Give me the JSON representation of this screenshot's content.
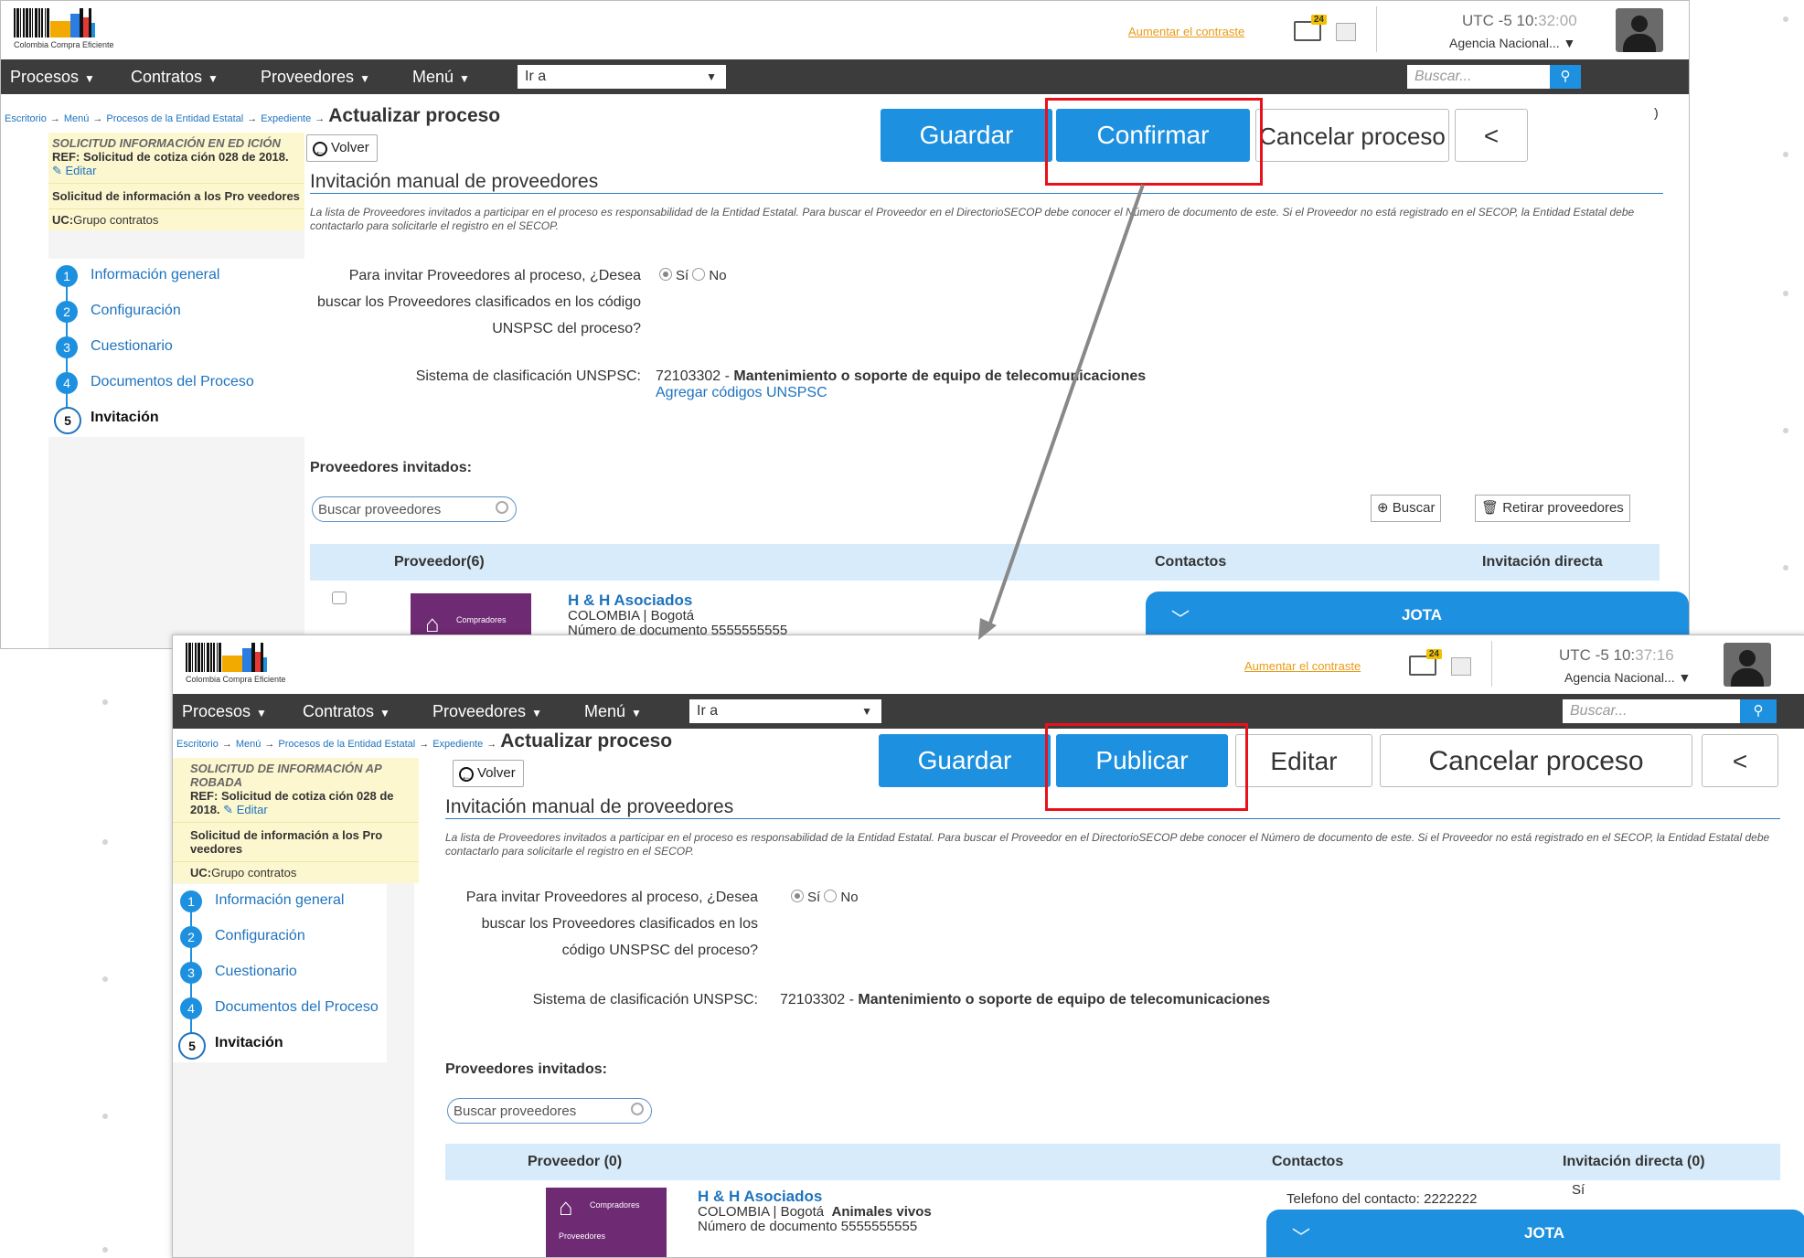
{
  "header": {
    "logo_text": "Colombia Compra Eficiente",
    "contrast_link": "Aumentar el contraste",
    "mail_count": "24",
    "agency": "Agencia Nacional...",
    "utc_1": "UTC -5 10:",
    "utc_1_sec": "32:00",
    "utc_2": "UTC -5 10:",
    "utc_2_sec": "37:16"
  },
  "nav": {
    "procesos": "Procesos",
    "contratos": "Contratos",
    "proveedores": "Proveedores",
    "menu": "Menú",
    "goto": "Ir a",
    "search_placeholder": "Buscar..."
  },
  "breadcrumb": {
    "escritorio": "Escritorio",
    "menu": "Menú",
    "procesos": "Procesos de la Entidad Estatal",
    "expediente": "Expediente",
    "current": "Actualizar proceso"
  },
  "actions_1": {
    "guardar": "Guardar",
    "confirmar": "Confirmar",
    "cancelar": "Cancelar proceso",
    "back": "<",
    "extra": ")"
  },
  "actions_2": {
    "guardar": "Guardar",
    "publicar": "Publicar",
    "editar": "Editar",
    "cancelar": "Cancelar proceso",
    "back": "<"
  },
  "sidebar_1": {
    "title": "SOLICITUD INFORMACIÓN EN ED ICIÓN",
    "ref": "REF: Solicitud de cotiza ción 028 de 2018.",
    "edit": "Editar",
    "subtitle": "Solicitud de información a los Pro veedores",
    "uc_label": "UC:",
    "uc_value": "Grupo contratos"
  },
  "sidebar_2": {
    "title": "SOLICITUD DE INFORMACIÓN AP ROBADA",
    "ref": "REF: Solicitud de cotiza ción 028 de 2018.",
    "edit": "Editar",
    "subtitle": "Solicitud de información a los Pro veedores",
    "uc_label": "UC:",
    "uc_value": "Grupo contratos"
  },
  "steps": [
    {
      "num": "1",
      "label": "Información general"
    },
    {
      "num": "2",
      "label": "Configuración"
    },
    {
      "num": "3",
      "label": "Cuestionario"
    },
    {
      "num": "4",
      "label": "Documentos del Proceso"
    },
    {
      "num": "5",
      "label": "Invitación"
    }
  ],
  "content": {
    "volver": "Volver",
    "section_title": "Invitación manual de proveedores",
    "description": "La lista de Proveedores invitados a participar en el proceso es responsabilidad de la Entidad Estatal. Para buscar el Proveedor en el DirectorioSECOP debe conocer el Número de documento de este. Si el Proveedor no está registrado en el SECOP, la Entidad Estatal debe contactarlo para solicitarle el registro en el SECOP.",
    "question": "Para invitar Proveedores al proceso, ¿Desea buscar los Proveedores clasificados en los código UNSPSC del proceso?",
    "yes": "Sí",
    "no": "No",
    "unspsc_label": "Sistema de clasificación UNSPSC:",
    "unspsc_code": "72103302 - ",
    "unspsc_desc": "Mantenimiento o soporte de equipo de telecomunicaciones",
    "add_codes": "Agregar códigos UNSPSC",
    "invited_label": "Proveedores invitados:",
    "search_providers": "Buscar proveedores",
    "buscar_btn": "Buscar",
    "retirar_btn": "Retirar proveedores"
  },
  "table_1": {
    "col_provider": "Proveedor(6)",
    "col_contacts": "Contactos",
    "col_direct": "Invitación directa"
  },
  "table_2": {
    "col_provider": "Proveedor (0)",
    "col_contacts": "Contactos",
    "col_direct": "Invitación directa (0)"
  },
  "provider": {
    "name": "H & H Asociados",
    "location": "COLOMBIA | Bogotá",
    "category": "Animales vivos",
    "doc": "Número de documento 5555555555",
    "logo_compradores": "Compradores",
    "logo_proveedores": "Proveedores",
    "contact": "Telefono del contacto: 2222222",
    "direct": "Sí"
  },
  "chat": {
    "title": "JOTA"
  },
  "colors": {
    "primary": "#1e90e0",
    "navbar": "#3c3c3c",
    "highlight": "#e8101a",
    "sidebar_yellow": "#fdf7cf"
  }
}
